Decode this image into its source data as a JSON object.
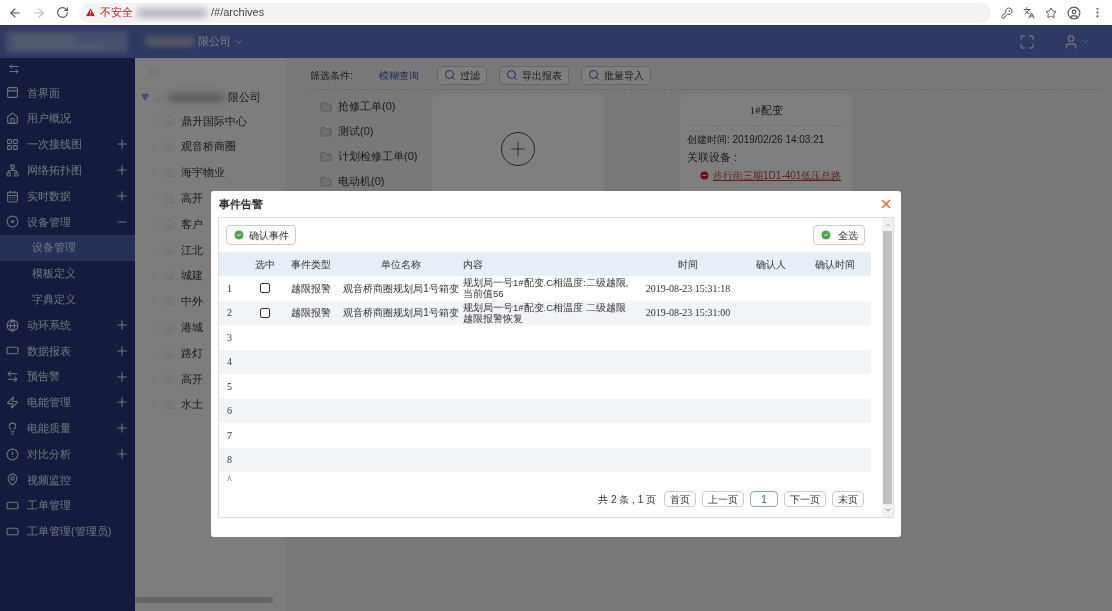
{
  "browser": {
    "security": "不安全",
    "url": "/#/archives"
  },
  "header": {
    "company": "限公司"
  },
  "sidebar": {
    "items": [
      {
        "label": "首界面",
        "kind": "link"
      },
      {
        "label": "用户概况",
        "kind": "link"
      },
      {
        "label": "一次接线图",
        "kind": "group",
        "expanded": false
      },
      {
        "label": "网络拓扑图",
        "kind": "group",
        "expanded": false
      },
      {
        "label": "实时数据",
        "kind": "group",
        "expanded": false
      },
      {
        "label": "设备管理",
        "kind": "group",
        "expanded": true,
        "children": [
          {
            "label": "设备管理",
            "selected": true
          },
          {
            "label": "模板定义",
            "selected": false
          },
          {
            "label": "字典定义",
            "selected": false
          }
        ]
      },
      {
        "label": "动环系统",
        "kind": "group",
        "expanded": false
      },
      {
        "label": "数据报表",
        "kind": "group",
        "expanded": false
      },
      {
        "label": "预告警",
        "kind": "group",
        "expanded": false
      },
      {
        "label": "电能管理",
        "kind": "group",
        "expanded": false
      },
      {
        "label": "电能质量",
        "kind": "group",
        "expanded": false
      },
      {
        "label": "对比分析",
        "kind": "group",
        "expanded": false
      },
      {
        "label": "视频监控",
        "kind": "link"
      },
      {
        "label": "工单管理",
        "kind": "link"
      },
      {
        "label": "工单管理(管理员)",
        "kind": "link"
      }
    ]
  },
  "tree": {
    "root": {
      "label": "限公司",
      "expanded": true
    },
    "children": [
      "鼎升国际中心",
      "观音桥商圈",
      "海宇物业",
      "高开",
      "客户",
      "江北",
      "城建",
      "中外",
      "港城",
      "路灯",
      "高开",
      "水土"
    ]
  },
  "filter": {
    "label": "筛选条件:",
    "link": "模糊查询",
    "buttons": [
      "过滤",
      "导出报表",
      "批量导入"
    ]
  },
  "folders": [
    "抢修工单(0)",
    "测试(0)",
    "计划检修工单(0)",
    "电动机(0)"
  ],
  "device_card": {
    "title": "1#配变",
    "created": "创建时间: 2019/02/26 14:03:21",
    "related_label": "关联设备 :",
    "device": "步行街三期1D1-401低压总路"
  },
  "dialog": {
    "title": "事件告警",
    "confirm_button": "确认事件",
    "select_all_button": "全选",
    "columns": [
      "",
      "选中",
      "事件类型",
      "单位名称",
      "内容",
      "时间",
      "确认人",
      "确认时间"
    ],
    "rows": [
      {
        "kind": "record",
        "index": "1",
        "checked": false,
        "event_type": "越限报警",
        "unit": "观音桥商圈规划局1号箱变",
        "content": "规划局一号1#配变.C相温度:二级越限,当前值56",
        "time": "2019-08-23 15:31:18"
      },
      {
        "kind": "record",
        "index": "2",
        "checked": false,
        "event_type": "越限报警",
        "unit": "观音桥商圈规划局1号箱变",
        "content": "规划局一号1#配变.C相温度 二级越限越限报警恢复",
        "time": "2019-08-23 15:31:00"
      },
      {
        "kind": "empty",
        "index": "3"
      },
      {
        "kind": "empty",
        "index": "4"
      },
      {
        "kind": "empty",
        "index": "5"
      },
      {
        "kind": "empty",
        "index": "6"
      },
      {
        "kind": "empty",
        "index": "7"
      },
      {
        "kind": "empty",
        "index": "8"
      },
      {
        "kind": "empty",
        "index": "^"
      }
    ],
    "pagination": {
      "summary": "共 2 条 , 1 页",
      "first": "首页",
      "prev": "上一页",
      "page": "1",
      "next": "下一页",
      "last": "末页"
    }
  }
}
